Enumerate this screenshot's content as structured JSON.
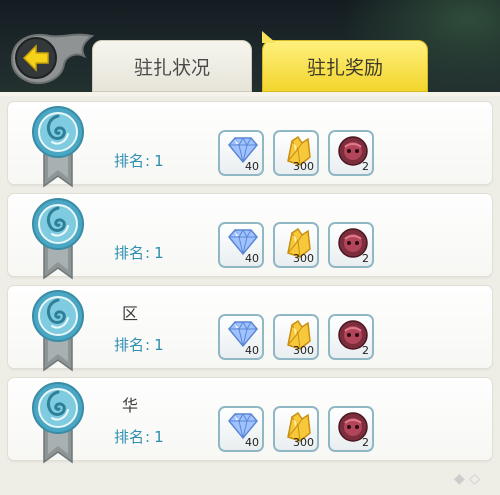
{
  "header": {
    "back_icon": "back-arrow-icon",
    "tabs": [
      {
        "label": "驻扎状况",
        "active": false
      },
      {
        "label": "驻扎奖励",
        "active": true
      }
    ]
  },
  "rows": [
    {
      "name": "",
      "rank_label": "排名",
      "rank_sep": ":",
      "rank_value": "1",
      "rewards": [
        {
          "icon": "diamond-icon",
          "count": "40"
        },
        {
          "icon": "crystal-icon",
          "count": "300"
        },
        {
          "icon": "red-orb-icon",
          "count": "2"
        }
      ]
    },
    {
      "name": "",
      "rank_label": "排名",
      "rank_sep": ":",
      "rank_value": "1",
      "rewards": [
        {
          "icon": "diamond-icon",
          "count": "40"
        },
        {
          "icon": "crystal-icon",
          "count": "300"
        },
        {
          "icon": "red-orb-icon",
          "count": "2"
        }
      ]
    },
    {
      "name": "区",
      "rank_label": "排名",
      "rank_sep": ":",
      "rank_value": "1",
      "rewards": [
        {
          "icon": "diamond-icon",
          "count": "40"
        },
        {
          "icon": "crystal-icon",
          "count": "300"
        },
        {
          "icon": "red-orb-icon",
          "count": "2"
        }
      ]
    },
    {
      "name": "华",
      "rank_label": "排名",
      "rank_sep": ":",
      "rank_value": "1",
      "rewards": [
        {
          "icon": "diamond-icon",
          "count": "40"
        },
        {
          "icon": "crystal-icon",
          "count": "300"
        },
        {
          "icon": "red-orb-icon",
          "count": "2"
        }
      ]
    }
  ],
  "colors": {
    "active_tab": "#f2d52c",
    "rank_text": "#2e8fb0",
    "medal_blue": "#5fb6cf",
    "ribbon_grey": "#8d9596"
  }
}
